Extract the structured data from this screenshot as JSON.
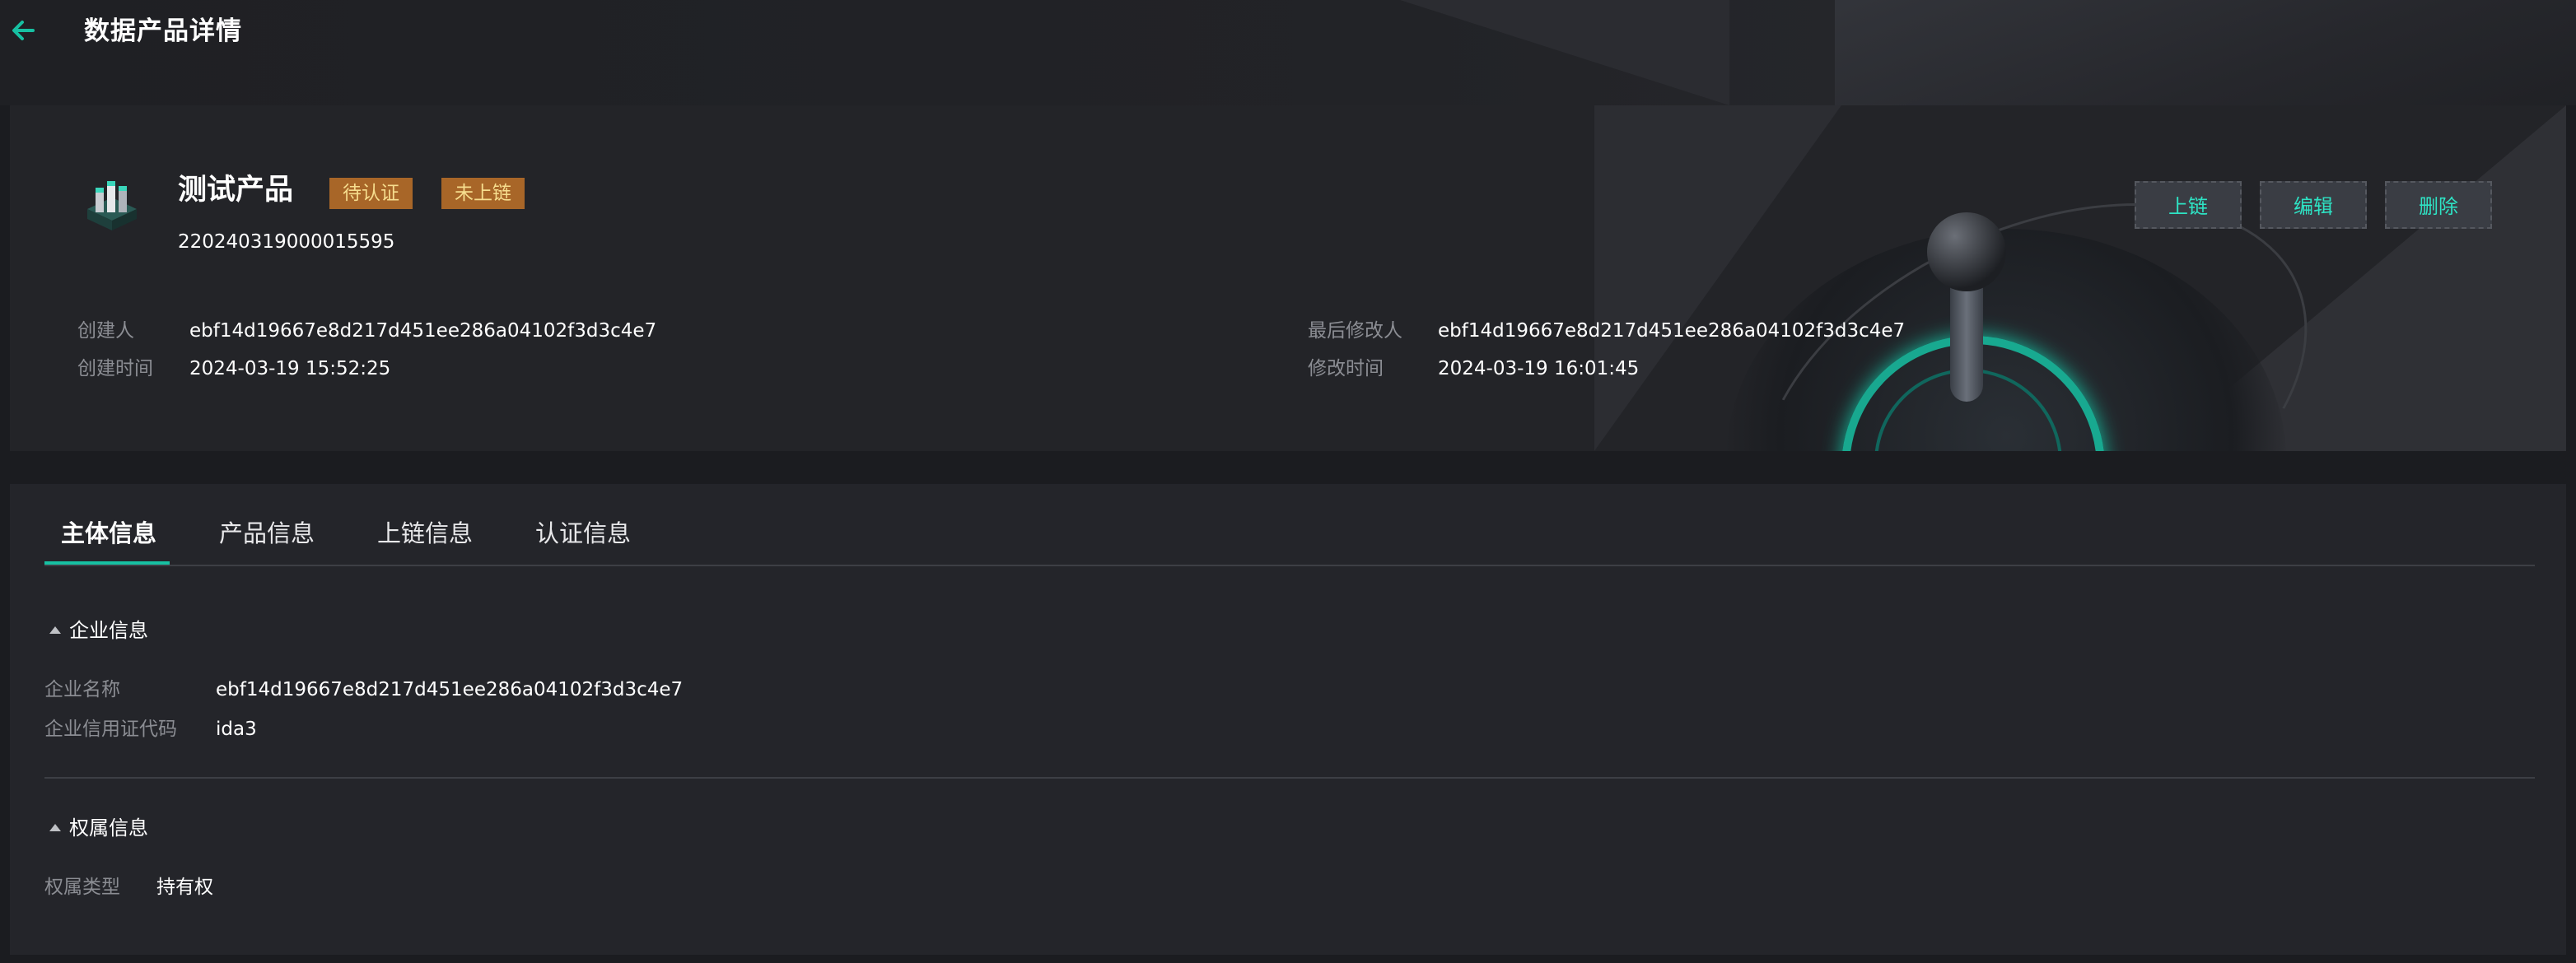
{
  "page": {
    "title": "数据产品详情",
    "back_icon": "arrow-left-icon"
  },
  "colors": {
    "accent": "#17c0a2",
    "tag_bg": "#a86628",
    "tag_text": "#f6dd8e",
    "background": "#1b1c20"
  },
  "product": {
    "name": "测试产品",
    "id": "220240319000015595",
    "tags": [
      "待认证",
      "未上链"
    ],
    "icon": "data-product-icon"
  },
  "actions": {
    "chain_label": "上链",
    "edit_label": "编辑",
    "delete_label": "删除"
  },
  "meta": {
    "creator_label": "创建人",
    "creator_value": "ebf14d19667e8d217d451ee286a04102f3d3c4e7",
    "created_time_label": "创建时间",
    "created_time_value": "2024-03-19 15:52:25",
    "modifier_label": "最后修改人",
    "modifier_value": "ebf14d19667e8d217d451ee286a04102f3d3c4e7",
    "modified_time_label": "修改时间",
    "modified_time_value": "2024-03-19 16:01:45"
  },
  "tabs": [
    {
      "label": "主体信息",
      "active": true
    },
    {
      "label": "产品信息",
      "active": false
    },
    {
      "label": "上链信息",
      "active": false
    },
    {
      "label": "认证信息",
      "active": false
    }
  ],
  "enterprise": {
    "section_title": "企业信息",
    "name_label": "企业名称",
    "name_value": "ebf14d19667e8d217d451ee286a04102f3d3c4e7",
    "credit_code_label": "企业信用证代码",
    "credit_code_value": "ida3"
  },
  "ownership": {
    "section_title": "权属信息",
    "type_label": "权属类型",
    "type_value": "持有权"
  }
}
